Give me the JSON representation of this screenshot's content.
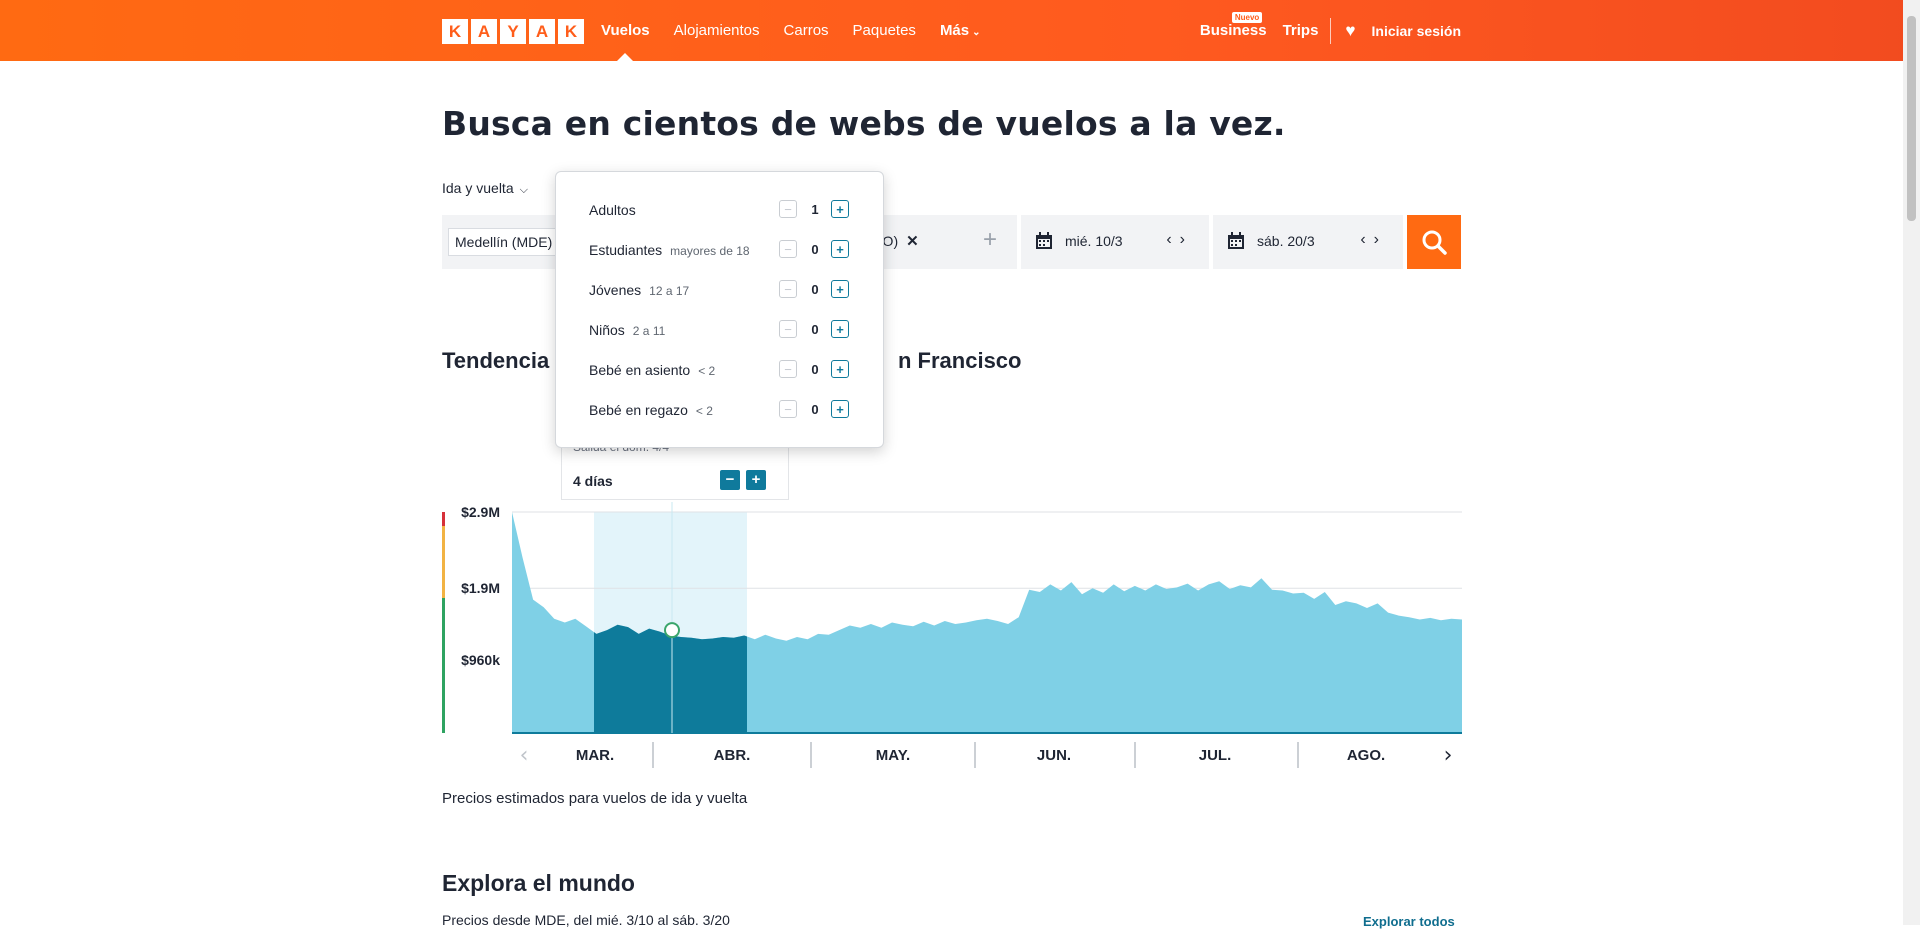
{
  "header": {
    "logo_letters": [
      "K",
      "A",
      "Y",
      "A",
      "K"
    ],
    "nav": [
      "Vuelos",
      "Alojamientos",
      "Carros",
      "Paquetes",
      "Más"
    ],
    "business": "Business",
    "new_badge": "Nuevo",
    "trips": "Trips",
    "login": "Iniciar sesión"
  },
  "search": {
    "title": "Busca en cientos de webs de vuelos a la vez.",
    "trip_type": "Ida y vuelta",
    "origin": "Medellín (MDE)",
    "destination_partial": "FO)",
    "depart_date": "mié. 10/3",
    "return_date": "sáb. 20/3"
  },
  "travelers_popover": {
    "rows": [
      {
        "label": "Adultos",
        "sub": "",
        "value": "1"
      },
      {
        "label": "Estudiantes",
        "sub": "mayores de 18",
        "value": "0"
      },
      {
        "label": "Jóvenes",
        "sub": "12 a 17",
        "value": "0"
      },
      {
        "label": "Niños",
        "sub": "2 a 11",
        "value": "0"
      },
      {
        "label": "Bebé en asiento",
        "sub": "< 2",
        "value": "0"
      },
      {
        "label": "Bebé en regazo",
        "sub": "< 2",
        "value": "0"
      }
    ]
  },
  "trend": {
    "title_start": "Tendencia",
    "title_end": "n Francisco",
    "tooltip_sub": "Salida el dom. 4/4",
    "tooltip_days": "4 días",
    "caption": "Precios estimados para vuelos de ida y vuelta"
  },
  "chart_data": {
    "type": "area",
    "ytick_labels": [
      "$2.9M",
      "$1.9M",
      "$960k"
    ],
    "ytick_values": [
      2900000,
      1900000,
      960000
    ],
    "ylim": [
      0,
      2900000
    ],
    "months": [
      "MAR.",
      "ABR.",
      "MAY.",
      "JUN.",
      "JUL.",
      "AGO."
    ],
    "selected_point": {
      "x": "4/4",
      "y": 1350000
    },
    "series": [
      {
        "x_index": [
          0,
          2,
          4,
          6,
          8,
          10,
          12,
          14,
          16,
          18,
          20,
          22,
          24,
          26,
          28,
          30,
          32,
          34,
          36,
          38,
          40,
          42,
          44,
          46,
          48,
          50,
          52,
          54,
          56,
          58,
          60,
          62,
          64,
          66,
          68,
          70,
          72,
          74,
          76,
          78,
          80,
          82,
          84,
          86,
          88,
          90,
          92,
          94,
          96,
          98,
          100,
          102,
          104,
          106,
          108,
          110,
          112,
          114,
          116,
          118,
          120,
          122,
          124,
          126,
          128,
          130,
          132,
          134,
          136,
          138,
          140,
          142,
          144,
          146,
          148,
          150,
          152,
          154,
          156,
          158,
          160,
          162,
          164,
          166,
          168,
          170,
          172,
          174,
          176,
          178,
          180
        ],
        "values": [
          2900000,
          2300000,
          1750000,
          1650000,
          1500000,
          1450000,
          1500000,
          1400000,
          1300000,
          1350000,
          1420000,
          1390000,
          1300000,
          1370000,
          1330000,
          1280000,
          1260000,
          1250000,
          1230000,
          1240000,
          1260000,
          1250000,
          1280000,
          1230000,
          1290000,
          1240000,
          1210000,
          1260000,
          1230000,
          1300000,
          1290000,
          1350000,
          1410000,
          1380000,
          1430000,
          1380000,
          1450000,
          1420000,
          1400000,
          1460000,
          1410000,
          1470000,
          1430000,
          1450000,
          1480000,
          1500000,
          1470000,
          1430000,
          1520000,
          1880000,
          1850000,
          1950000,
          1870000,
          1980000,
          1820000,
          1900000,
          1840000,
          1950000,
          1860000,
          1930000,
          1870000,
          1950000,
          1890000,
          1910000,
          1960000,
          1870000,
          1950000,
          1990000,
          1890000,
          1940000,
          1910000,
          2030000,
          1880000,
          1870000,
          1830000,
          1840000,
          1760000,
          1850000,
          1680000,
          1730000,
          1700000,
          1640000,
          1700000,
          1580000,
          1540000,
          1520000,
          1490000,
          1510000,
          1480000,
          1500000,
          1490000
        ]
      }
    ]
  }
}
